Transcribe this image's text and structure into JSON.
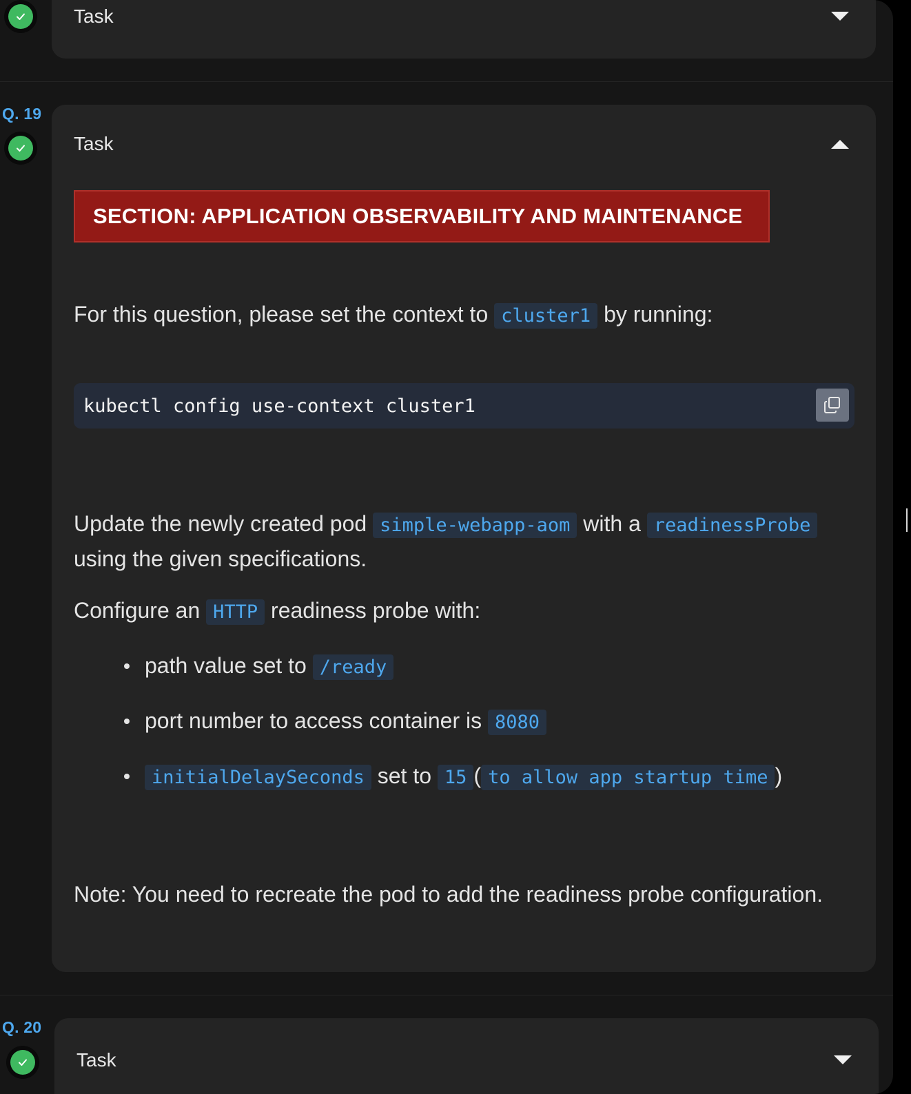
{
  "q18": {
    "card_title": "Task",
    "chevron_icon": "chevron-down-icon",
    "status_icon": "check-circle-icon"
  },
  "q19": {
    "label": "Q. 19",
    "card_title": "Task",
    "chevron_icon": "chevron-up-icon",
    "status_icon": "check-circle-icon",
    "section_banner": "SECTION: APPLICATION OBSERVABILITY AND MAINTENANCE",
    "context_intro": {
      "before": "For this question, please set the context to",
      "context_name": "cluster1",
      "after": "by running:"
    },
    "command": "kubectl config use-context cluster1",
    "copy_icon": "copy-icon",
    "update": {
      "before": "Update the newly created pod",
      "pod_name": "simple-webapp-aom",
      "middle": "with a",
      "probe_name": "readinessProbe",
      "after": "using the given specifications."
    },
    "configure": {
      "before": "Configure an",
      "protocol": "HTTP",
      "after": "readiness probe with:"
    },
    "specs": {
      "path_text": "path value set to",
      "path_value": "/ready",
      "port_text": "port number to access container is",
      "port_value": "8080",
      "delay_key": "initialDelaySeconds",
      "delay_text": "set to",
      "delay_value": "15",
      "paren_open": "(",
      "delay_note": "to allow app startup time",
      "paren_close": ")"
    },
    "note": "Note: You need to recreate the pod to add the readiness probe configuration."
  },
  "q20": {
    "label": "Q. 20",
    "card_title": "Task",
    "chevron_icon": "chevron-down-icon",
    "status_icon": "check-circle-icon"
  },
  "colors": {
    "accent_blue": "#4ea8ee",
    "success_green": "#3fb960",
    "banner_red": "#931a16",
    "card_bg": "#242424",
    "page_bg": "#161616"
  }
}
